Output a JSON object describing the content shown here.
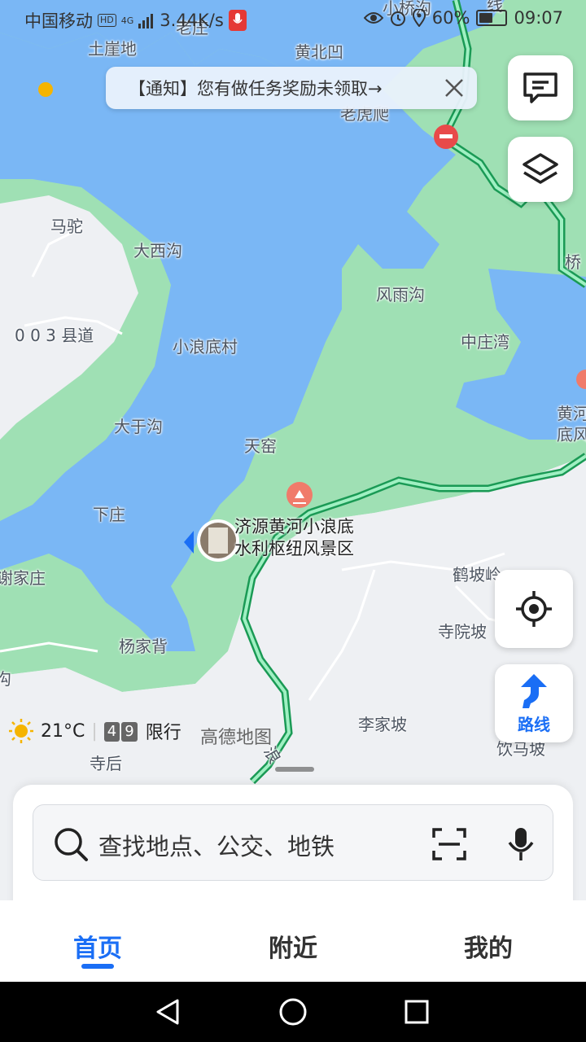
{
  "status_bar": {
    "carrier": "中国移动",
    "hd": "HD",
    "network": "4G",
    "speed": "3.44K/s",
    "battery": "60%",
    "battery_level": 0.6,
    "time": "09:07",
    "icons": [
      "eye-icon",
      "alarm-icon",
      "location-icon",
      "battery-icon",
      "mic-icon",
      "signal-icon"
    ]
  },
  "notice": {
    "text": "【通知】您有做任务奖励未领取→"
  },
  "map": {
    "labels": {
      "laozhuang": "老庄",
      "xiaoqiaogou": "小桥沟",
      "tuyadi": "土崖地",
      "huangbeiao": "黄北凹",
      "laohupo": "老虎爬",
      "matuo": "马驼",
      "daxigou": "大西沟",
      "fengyugou": "风雨沟",
      "road003": "0 0 3 县道",
      "zhongzhuangwan": "中庄湾",
      "xiaolangdicun": "小浪底村",
      "dayugou": "大于沟",
      "tianyao": "天窑",
      "xiazhuang": "下庄",
      "xiejiazhuang": "谢家庄",
      "hepoling": "鹤坡岭",
      "siyuanpo": "寺院坡",
      "yangjiabei": "杨家背",
      "lijiapo": "李家坡",
      "sihou": "寺后",
      "yinmapo": "饮马坡",
      "huanghe_1": "黄河",
      "huanghe_2": "底风",
      "qiao": "桥",
      "road_lang": "浪",
      "road_yi": "线",
      "gou_left": "沟"
    },
    "scenic": {
      "line1": "济源黄河小浪底",
      "line2": "水利枢纽风景区"
    },
    "colors": {
      "land": "#eef0f3",
      "water": "#7ab7f5",
      "green": "#9fe0b4",
      "road": "#22c06e",
      "accent": "#1a6ef5"
    }
  },
  "buttons": {
    "route": "路线",
    "message_icon": "message-icon",
    "layers_icon": "layers-icon",
    "locate_icon": "locate-icon"
  },
  "weather": {
    "temp": "21°C",
    "plate_1": "4",
    "plate_2": "9",
    "restriction": "限行"
  },
  "watermark": "高德地图",
  "search": {
    "placeholder": "查找地点、公交、地铁"
  },
  "tabs": [
    {
      "label": "首页",
      "active": true
    },
    {
      "label": "附近",
      "active": false
    },
    {
      "label": "我的",
      "active": false
    }
  ]
}
